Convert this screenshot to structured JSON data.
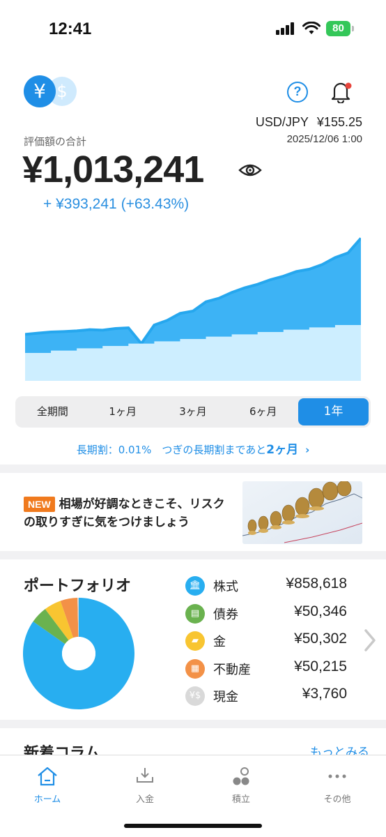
{
  "status_bar": {
    "time": "12:41",
    "battery": "80"
  },
  "header": {
    "currency_yen": "¥",
    "currency_usd": "$",
    "help_glyph": "?",
    "fx_pair": "USD/JPY",
    "fx_rate": "¥155.25",
    "fx_datetime": "2025/12/06 1:00"
  },
  "summary": {
    "total_label": "評価額の合計",
    "total_value": "¥1,013,241",
    "gain_amount": "+ ¥393,241",
    "gain_percent": "(+63.43%)"
  },
  "chart_data": {
    "type": "area",
    "x": [
      0,
      1,
      2,
      3,
      4,
      5,
      6,
      7,
      8,
      9,
      10,
      11,
      12,
      13,
      14,
      15,
      16,
      17,
      18,
      19,
      20,
      21,
      22,
      23,
      24,
      25,
      26
    ],
    "series": [
      {
        "values": [
          600000,
          605000,
          610000,
          612000,
          615000,
          620000,
          618000,
          625000,
          628000,
          560000,
          640000,
          660000,
          690000,
          700000,
          740000,
          755000,
          780000,
          800000,
          815000,
          835000,
          850000,
          870000,
          880000,
          900000,
          930000,
          950000,
          1013241
        ]
      },
      {
        "values": [
          520000,
          520000,
          530000,
          530000,
          540000,
          540000,
          550000,
          550000,
          560000,
          560000,
          570000,
          570000,
          580000,
          580000,
          590000,
          590000,
          600000,
          600000,
          610000,
          610000,
          620000,
          620000,
          630000,
          630000,
          640000,
          640000,
          650000
        ]
      }
    ],
    "colors": {
      "value": "#3db3f5",
      "value_edge": "#26a7ee",
      "principal": "#cdeeff"
    }
  },
  "period_tabs": [
    "全期間",
    "1ヶ月",
    "3ヶ月",
    "6ヶ月",
    "1年"
  ],
  "period_active_index": 4,
  "long_term": {
    "prefix": "長期割：0.01%　つぎの長期割まであと",
    "months": "2ヶ月"
  },
  "news": {
    "badge": "NEW",
    "text": "相場が好調なときこそ、リスクの取りすぎに気をつけましょう"
  },
  "portfolio": {
    "title": "ポートフォリオ",
    "assets": [
      {
        "name": "株式",
        "value": "¥858,618",
        "icon": "bank-icon",
        "color": "#28aef0"
      },
      {
        "name": "債券",
        "value": "¥50,346",
        "icon": "bond-icon",
        "color": "#6ab24f"
      },
      {
        "name": "金",
        "value": "¥50,302",
        "icon": "gold-icon",
        "color": "#f8c531"
      },
      {
        "name": "不動産",
        "value": "¥50,215",
        "icon": "building-icon",
        "color": "#f39147"
      },
      {
        "name": "現金",
        "value": "¥3,760",
        "icon": "cash-icon",
        "color": "#d9d9d9"
      }
    ]
  },
  "columns": {
    "title": "新着コラム",
    "more": "もっとみる"
  },
  "tabbar": {
    "items": [
      {
        "label": "ホーム",
        "icon": "home-icon"
      },
      {
        "label": "入金",
        "icon": "deposit-icon"
      },
      {
        "label": "積立",
        "icon": "accumulate-icon"
      },
      {
        "label": "その他",
        "icon": "more-icon"
      }
    ]
  }
}
